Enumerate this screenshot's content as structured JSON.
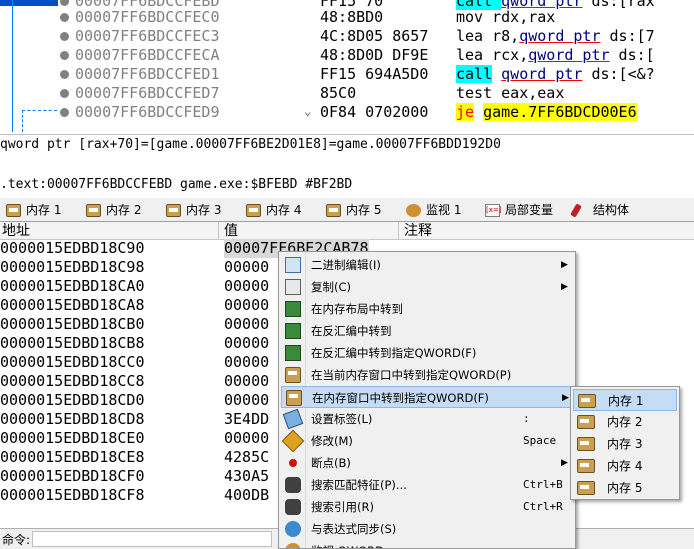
{
  "disassembly": {
    "lines": [
      {
        "addr": "00007FF6BDCCFEBD",
        "bytes": "FF15 70",
        "instr_parts": [
          {
            "t": "call ",
            "cls": "hl-cyan"
          },
          {
            "t": "qword ptr",
            "cls": "ul"
          },
          {
            "t": " ds:[rax",
            "cls": ""
          }
        ]
      },
      {
        "addr": "00007FF6BDCCFEC0",
        "bytes": "48:8BD0",
        "instr_parts": [
          {
            "t": "mov rdx,rax",
            "cls": ""
          }
        ]
      },
      {
        "addr": "00007FF6BDCCFEC3",
        "bytes": "4C:8D05 8657",
        "instr_parts": [
          {
            "t": "lea r8,",
            "cls": ""
          },
          {
            "t": "qword ptr",
            "cls": "ul"
          },
          {
            "t": " ds:[7",
            "cls": ""
          }
        ]
      },
      {
        "addr": "00007FF6BDCCFECA",
        "bytes": "48:8D0D DF9E",
        "instr_parts": [
          {
            "t": "lea rcx,",
            "cls": ""
          },
          {
            "t": "qword ptr",
            "cls": "ul"
          },
          {
            "t": " ds:[",
            "cls": ""
          }
        ]
      },
      {
        "addr": "00007FF6BDCCFED1",
        "bytes": "FF15 694A5D0",
        "instr_parts": [
          {
            "t": "call",
            "cls": "hl-cyan"
          },
          {
            "t": " ",
            "cls": ""
          },
          {
            "t": "qword ptr",
            "cls": "ul"
          },
          {
            "t": " ds:[<&?",
            "cls": ""
          }
        ]
      },
      {
        "addr": "00007FF6BDCCFED7",
        "bytes": "85C0",
        "instr_parts": [
          {
            "t": "test eax,eax",
            "cls": ""
          }
        ]
      },
      {
        "addr": "00007FF6BDCCFED9",
        "bytes": "0F84 0702000",
        "instr_parts": [
          {
            "t": "je",
            "cls": "hl-yellow"
          },
          {
            "t": " ",
            "cls": ""
          },
          {
            "t": "game.7FF6BDCD00E6",
            "cls": "hl-yellow-target"
          }
        ]
      }
    ],
    "scroll_glyph": "⌄"
  },
  "info": {
    "line1": "qword ptr [rax+70]=[game.00007FF6BE2D01E8]=game.00007FF6BDD192D0",
    "line2": ".text:00007FF6BDCCFEBD game.exe:$BFEBD #BF2BD"
  },
  "tabs": [
    {
      "label": "内存 1",
      "icon": "memory-icon",
      "active": false
    },
    {
      "label": "内存 2",
      "icon": "memory-icon",
      "active": false
    },
    {
      "label": "内存 3",
      "icon": "memory-icon",
      "active": false
    },
    {
      "label": "内存 4",
      "icon": "memory-icon",
      "active": false
    },
    {
      "label": "内存 5",
      "icon": "memory-icon",
      "active": false
    },
    {
      "label": "监视 1",
      "icon": "watch-icon",
      "active": false
    },
    {
      "label": "局部变量",
      "icon": "local-vars-icon",
      "active": false
    },
    {
      "label": "结构体",
      "icon": "struct-icon",
      "active": false
    }
  ],
  "dump": {
    "headers": {
      "address": "地址",
      "value": "值",
      "comment": "注释"
    },
    "rows": [
      {
        "addr": "0000015EDBD18C90",
        "value": "00007FF6BE2CAB78",
        "selected": true
      },
      {
        "addr": "0000015EDBD18C98",
        "value": "00000"
      },
      {
        "addr": "0000015EDBD18CA0",
        "value": "00000"
      },
      {
        "addr": "0000015EDBD18CA8",
        "value": "00000"
      },
      {
        "addr": "0000015EDBD18CB0",
        "value": "00000"
      },
      {
        "addr": "0000015EDBD18CB8",
        "value": "00000"
      },
      {
        "addr": "0000015EDBD18CC0",
        "value": "00000"
      },
      {
        "addr": "0000015EDBD18CC8",
        "value": "00000"
      },
      {
        "addr": "0000015EDBD18CD0",
        "value": "00000"
      },
      {
        "addr": "0000015EDBD18CD8",
        "value": "3E4DD"
      },
      {
        "addr": "0000015EDBD18CE0",
        "value": "00000"
      },
      {
        "addr": "0000015EDBD18CE8",
        "value": "4285C"
      },
      {
        "addr": "0000015EDBD18CF0",
        "value": "430A5"
      },
      {
        "addr": "0000015EDBD18CF8",
        "value": "400DB"
      }
    ]
  },
  "command_bar": {
    "label": "命令:"
  },
  "context_menu": {
    "items": [
      {
        "label": "二进制编辑(I)",
        "shortcut": "",
        "submenu": true,
        "icon": "binary-edit-icon",
        "name": "menu-binary-edit"
      },
      {
        "label": "复制(C)",
        "shortcut": "",
        "submenu": true,
        "icon": "copy-icon",
        "name": "menu-copy"
      },
      {
        "label": "在内存布局中转到",
        "shortcut": "",
        "submenu": false,
        "icon": "memory-map-icon",
        "name": "menu-goto-memory-map"
      },
      {
        "label": "在反汇编中转到",
        "shortcut": "",
        "submenu": false,
        "icon": "disasm-icon",
        "name": "menu-goto-disasm"
      },
      {
        "label": "在反汇编中转到指定QWORD(F)",
        "shortcut": "",
        "submenu": false,
        "icon": "disasm-qword-icon",
        "name": "menu-goto-disasm-qword"
      },
      {
        "label": "在当前内存窗口中转到指定QWORD(P)",
        "shortcut": "",
        "submenu": false,
        "icon": "memory-icon",
        "name": "menu-goto-current-dump-qword"
      },
      {
        "label": "在内存窗口中转到指定QWORD(F)",
        "shortcut": "",
        "submenu": true,
        "icon": "memory-icon",
        "name": "menu-goto-dump-qword",
        "hot": true
      },
      {
        "label": "设置标签(L)",
        "shortcut": ":",
        "submenu": false,
        "icon": "label-icon",
        "name": "menu-set-label"
      },
      {
        "label": "修改(M)",
        "shortcut": "Space",
        "submenu": false,
        "icon": "pencil-icon",
        "name": "menu-modify"
      },
      {
        "label": "断点(B)",
        "shortcut": "",
        "submenu": true,
        "icon": "breakpoint-icon",
        "name": "menu-breakpoint"
      },
      {
        "label": "搜索匹配特征(P)...",
        "shortcut": "Ctrl+B",
        "submenu": false,
        "icon": "binoculars-icon",
        "name": "menu-search-pattern"
      },
      {
        "label": "搜索引用(R)",
        "shortcut": "Ctrl+R",
        "submenu": false,
        "icon": "binoculars-icon",
        "name": "menu-find-references"
      },
      {
        "label": "与表达式同步(S)",
        "shortcut": "",
        "submenu": false,
        "icon": "sync-icon",
        "name": "menu-sync-expression"
      },
      {
        "label": "监视 QWORD",
        "shortcut": "",
        "submenu": false,
        "icon": "watch-icon",
        "name": "menu-watch-qword"
      }
    ],
    "submenu_arrow": "▶"
  },
  "submenu": {
    "items": [
      {
        "label": "内存 1",
        "hot": true
      },
      {
        "label": "内存 2"
      },
      {
        "label": "内存 3"
      },
      {
        "label": "内存 4"
      },
      {
        "label": "内存 5"
      }
    ]
  }
}
